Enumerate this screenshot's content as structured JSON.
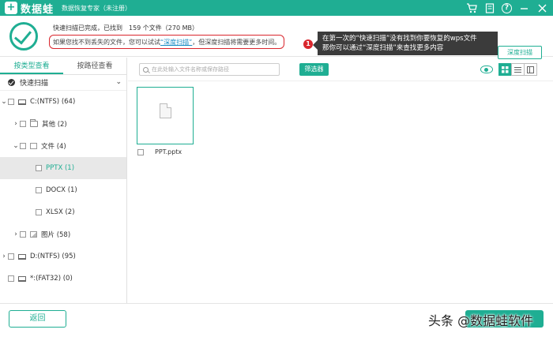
{
  "app": {
    "logo_glyph": "+",
    "name": "数据蛙",
    "subtitle": "数据恢复专家（未注册）",
    "accent_color": "#1fae93",
    "window_controls": [
      "cart-icon",
      "register-icon",
      "help-icon",
      "minimize-icon",
      "close-icon"
    ]
  },
  "banner": {
    "status_line": "快速扫描已完成，已找到　159 个文件（270 MB）",
    "hint_prefix": "如果您找不到丢失的文件，您可以试试",
    "hint_link": "“深度扫描”",
    "hint_suffix": "，但深度扫描将需要更多时间。",
    "badge_number": "1",
    "callout_line1": "在第一次的“快速扫描”没有找到你要恢复的wps文件",
    "callout_line2": "那你可以通过“深度扫描”来查找更多内容",
    "deep_scan_button": "深度扫描"
  },
  "left_panel": {
    "tabs": [
      {
        "label": "按类型查看",
        "active": true
      },
      {
        "label": "按路径查看",
        "active": false
      }
    ],
    "scan_mode": "快速扫描",
    "tree": [
      {
        "label": "C:(NTFS) (64)"
      },
      {
        "label": "其他 (2)"
      },
      {
        "label": "文件 (4)"
      },
      {
        "label": "PPTX (1)"
      },
      {
        "label": "DOCX (1)"
      },
      {
        "label": "XLSX (2)"
      },
      {
        "label": "图片 (58)"
      },
      {
        "label": "D:(NTFS) (95)"
      },
      {
        "label": "*:(FAT32) (0)"
      }
    ]
  },
  "right_panel": {
    "search_placeholder": "在此处输入文件名称或保存路径",
    "filter_button": "筛选器",
    "view_modes": [
      "grid-view-icon",
      "list-view-icon",
      "detail-view-icon"
    ],
    "files": [
      {
        "name": "PPT.pptx"
      }
    ]
  },
  "footer": {
    "back_button": "返回",
    "watermark": "头条 @数据蛙软件"
  }
}
